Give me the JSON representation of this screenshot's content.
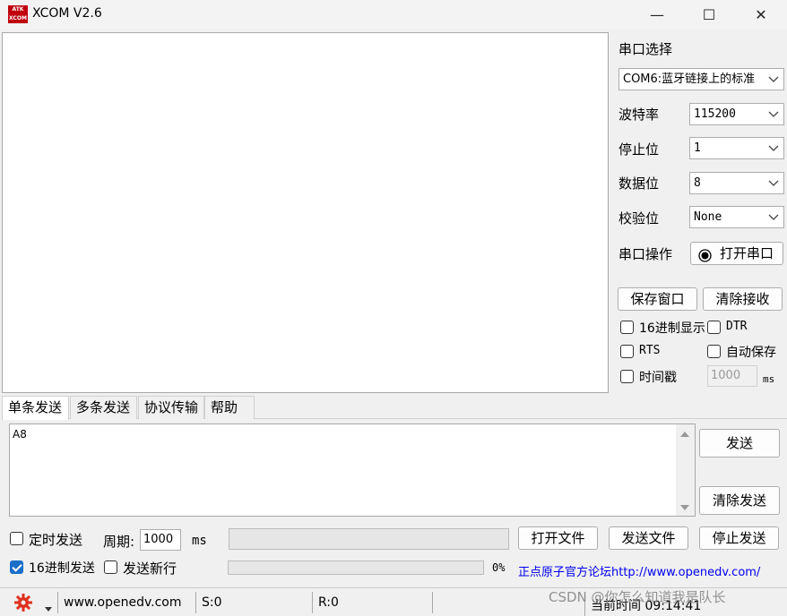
{
  "window": {
    "logo_line1": "ATK",
    "logo_line2": "XCOM",
    "title": "XCOM V2.6",
    "minimize_glyph": "—",
    "maximize_glyph": "☐",
    "close_glyph": "✕"
  },
  "serial": {
    "port_label": "串口选择",
    "port_value": "COM6:蓝牙链接上的标准",
    "baud_label": "波特率",
    "baud_value": "115200",
    "stop_label": "停止位",
    "stop_value": "1",
    "data_label": "数据位",
    "data_value": "8",
    "parity_label": "校验位",
    "parity_value": "None",
    "op_label": "串口操作",
    "open_button": "打开串口"
  },
  "receive_options": {
    "save_window": "保存窗口",
    "clear_receive": "清除接收",
    "hex_display": "16进制显示",
    "dtr": "DTR",
    "rts": "RTS",
    "auto_save": "自动保存",
    "timestamp": "时间戳",
    "timestamp_value": "1000",
    "timestamp_unit": "ms"
  },
  "tabs": [
    "单条发送",
    "多条发送",
    "协议传输",
    "帮助"
  ],
  "send": {
    "text": "A8",
    "send_button": "发送",
    "clear_send_button": "清除发送",
    "timed_send": "定时发送",
    "period_label": "周期:",
    "period_value": "1000",
    "period_unit": "ms",
    "open_file": "打开文件",
    "send_file": "发送文件",
    "stop_send": "停止发送",
    "hex_send": "16进制发送",
    "send_newline": "发送新行",
    "progress_percent": "0%",
    "forum_link": "正点原子官方论坛http://www.openedv.com/"
  },
  "status": {
    "url": "www.openedv.com",
    "sent": "S:0",
    "received": "R:0",
    "current_time": "当前时间 09:14:41"
  },
  "watermark": "CSDN @你怎么知道我是队长",
  "colors": {
    "accent": "#1a6fc9",
    "logo": "#c0000e",
    "gear": "#e0301e",
    "link": "#0000ee"
  }
}
